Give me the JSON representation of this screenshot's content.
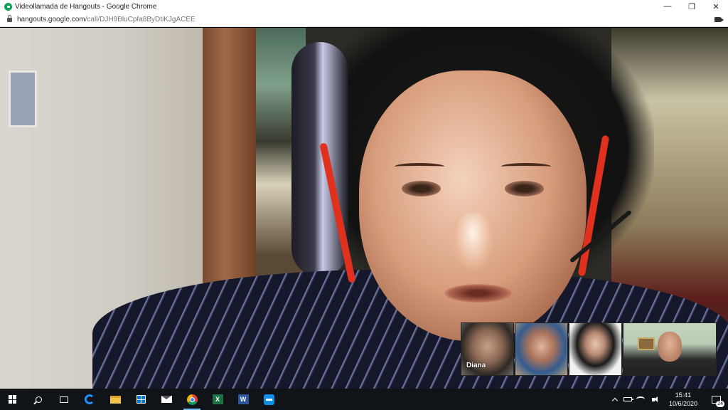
{
  "window": {
    "title": "Videollamada de Hangouts - Google Chrome",
    "minimize": "—",
    "restore": "❐",
    "close": "✕"
  },
  "address": {
    "host": "hangouts.google.com",
    "path": "/call/DJH9BluCpfa8ByDtiKJgACEE"
  },
  "participants": [
    {
      "label": "Diana",
      "active": true
    },
    {
      "label": "",
      "active": false
    },
    {
      "label": "",
      "active": false
    },
    {
      "label": "",
      "active": false
    }
  ],
  "taskbar": {
    "apps": [
      "start",
      "search",
      "task-view",
      "edge",
      "file-explorer",
      "store",
      "mail",
      "chrome",
      "excel",
      "word",
      "teamviewer"
    ],
    "excel_letter": "X",
    "word_letter": "W",
    "time": "15:41",
    "date": "10/6/2020",
    "notifications": "24"
  },
  "colors": {
    "chrome_title_bg": "#ffffff",
    "taskbar_bg": "#101418",
    "hangouts_green": "#0f9d58"
  }
}
